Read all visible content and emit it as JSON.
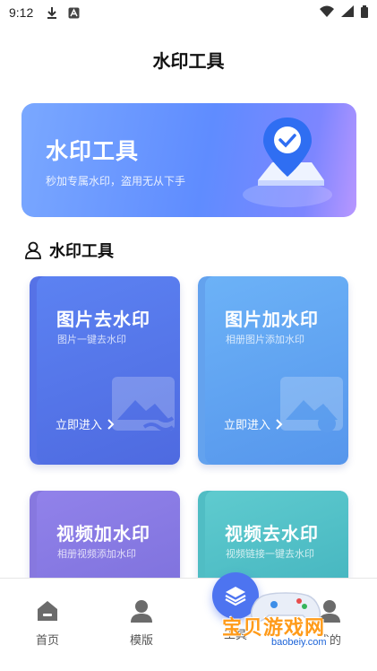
{
  "status_bar": {
    "time": "9:12"
  },
  "header": {
    "title": "水印工具"
  },
  "banner": {
    "title": "水印工具",
    "subtitle": "秒加专属水印，盗用无从下手"
  },
  "section": {
    "title": "水印工具"
  },
  "cards": [
    {
      "title": "图片去水印",
      "subtitle": "图片一键去水印",
      "enter": "立即进入"
    },
    {
      "title": "图片加水印",
      "subtitle": "相册图片添加水印",
      "enter": "立即进入"
    },
    {
      "title": "视频加水印",
      "subtitle": "相册视频添加水印"
    },
    {
      "title": "视频去水印",
      "subtitle": "视频链接一键去水印"
    }
  ],
  "tabs": [
    {
      "label": "首页",
      "icon": "home-icon"
    },
    {
      "label": "模版",
      "icon": "user-icon"
    },
    {
      "label": "工具",
      "icon": "layers-icon"
    },
    {
      "label": "我的",
      "icon": "profile-icon"
    }
  ],
  "watermark": {
    "text": "宝贝游戏网",
    "url": "baobeiy.com"
  },
  "colors": {
    "accent": "#4d74f0",
    "card1": "#5672e6",
    "card2": "#63a2ee",
    "card3": "#8778df",
    "card4": "#50bdc4"
  }
}
